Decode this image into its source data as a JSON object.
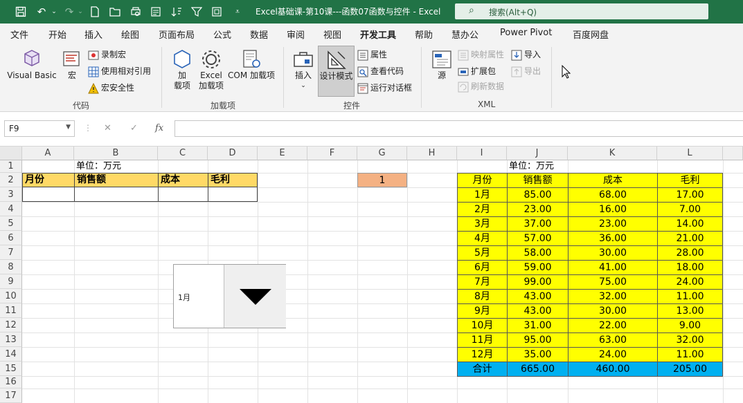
{
  "titlebar": {
    "title": "Excel基础课-第10课---函数07函数与控件  -  Excel",
    "search_placeholder": "搜索(Alt+Q)",
    "quick_access_icons": [
      "save-icon",
      "undo-icon",
      "redo-icon",
      "new-file-icon",
      "open-folder-icon",
      "print-preview-icon",
      "form-icon",
      "sort-icon",
      "filter-icon",
      "frame-icon",
      "customize-dropdown-icon"
    ],
    "accent_color": "#217346"
  },
  "menu": {
    "tabs": [
      "文件",
      "开始",
      "插入",
      "绘图",
      "页面布局",
      "公式",
      "数据",
      "审阅",
      "视图",
      "开发工具",
      "帮助",
      "慧办公",
      "Power Pivot",
      "百度网盘"
    ],
    "active": "开发工具"
  },
  "ribbon": {
    "code_group": {
      "label": "代码",
      "visual_basic": "Visual Basic",
      "macro": "宏",
      "record_macro": "录制宏",
      "relative_ref": "使用相对引用",
      "macro_security": "宏安全性"
    },
    "addins_group": {
      "label": "加载项",
      "addins_line1": "加",
      "addins_line2": "载项",
      "excel_addins_line1": "Excel",
      "excel_addins_line2": "加载项",
      "com_addins": "COM 加载项"
    },
    "controls_group": {
      "label": "控件",
      "insert": "插入",
      "design_mode": "设计模式",
      "properties": "属性",
      "view_code": "查看代码",
      "run_dialog": "运行对话框"
    },
    "xml_group": {
      "label": "XML",
      "source": "源",
      "map_properties": "映射属性",
      "expansion_packs": "扩展包",
      "refresh_data": "刷新数据",
      "import": "导入",
      "export": "导出"
    }
  },
  "formula_bar": {
    "name_box": "F9",
    "cancel_icon": "✕",
    "enter_icon": "✓",
    "fx_label": "fx",
    "formula": ""
  },
  "sheet": {
    "columns": [
      "A",
      "B",
      "C",
      "D",
      "E",
      "F",
      "G",
      "H",
      "I",
      "J",
      "K",
      "L"
    ],
    "rows": [
      "1",
      "2",
      "3",
      "4",
      "5",
      "6",
      "7",
      "8",
      "9",
      "10",
      "11",
      "12",
      "13",
      "14",
      "15",
      "16",
      "17"
    ],
    "left_unit": "单位：万元",
    "left_headers": [
      "月份",
      "销售额",
      "成本",
      "毛利"
    ],
    "g2_value": "1",
    "right_unit": "单位：万元",
    "right_headers": [
      "月份",
      "销售额",
      "成本",
      "毛利"
    ],
    "right_rows": [
      [
        "1月",
        "85.00",
        "68.00",
        "17.00"
      ],
      [
        "2月",
        "23.00",
        "16.00",
        "7.00"
      ],
      [
        "3月",
        "37.00",
        "23.00",
        "14.00"
      ],
      [
        "4月",
        "57.00",
        "36.00",
        "21.00"
      ],
      [
        "5月",
        "58.00",
        "30.00",
        "28.00"
      ],
      [
        "6月",
        "59.00",
        "41.00",
        "18.00"
      ],
      [
        "7月",
        "99.00",
        "75.00",
        "24.00"
      ],
      [
        "8月",
        "43.00",
        "32.00",
        "11.00"
      ],
      [
        "9月",
        "43.00",
        "30.00",
        "13.00"
      ],
      [
        "10月",
        "31.00",
        "22.00",
        "9.00"
      ],
      [
        "11月",
        "95.00",
        "63.00",
        "32.00"
      ],
      [
        "12月",
        "35.00",
        "24.00",
        "11.00"
      ]
    ],
    "total_row": [
      "合计",
      "665.00",
      "460.00",
      "205.00"
    ],
    "combo_value": "1月",
    "colors": {
      "header_orange": "#ffd966",
      "g2_fill": "#f4b183",
      "table_yellow": "#ffff00",
      "total_blue": "#00b0f0"
    }
  }
}
